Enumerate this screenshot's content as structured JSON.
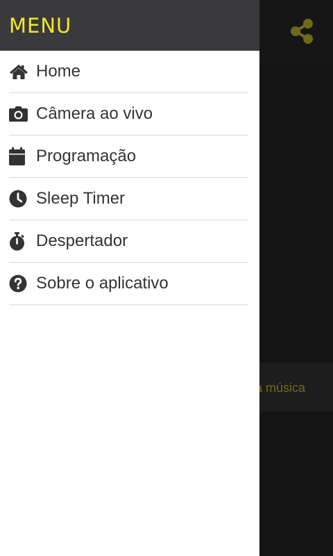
{
  "drawer": {
    "title": "MENU",
    "items": [
      {
        "label": "Home",
        "icon": "home-icon"
      },
      {
        "label": "Câmera ao vivo",
        "icon": "camera-icon"
      },
      {
        "label": "Programação",
        "icon": "calendar-icon"
      },
      {
        "label": "Sleep Timer",
        "icon": "clock-icon"
      },
      {
        "label": "Despertador",
        "icon": "stopwatch-icon"
      },
      {
        "label": "Sobre o aplicativo",
        "icon": "help-icon"
      }
    ]
  },
  "background": {
    "share_icon": "share-icon",
    "strip_text": "a música"
  },
  "colors": {
    "drawer_header": "#3a393b",
    "accent": "#f2e72a",
    "text": "#333333",
    "divider": "#d9d9d9",
    "dim_accent": "#6f6a1d",
    "background": "#141414"
  }
}
